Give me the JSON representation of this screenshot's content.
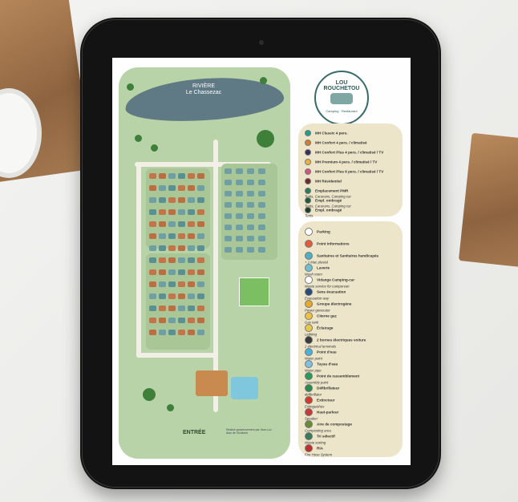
{
  "map": {
    "river_line1": "RIVIÈRE",
    "river_line2": "Le Chassezac",
    "entrance": "ENTRÉE",
    "footer_credit": "Réalisé gracieusement par Jean-Luc Alan de l'Ardèche"
  },
  "brand": {
    "name": "LOU ROUCHETOU",
    "tagline": "Camping · Restaurant"
  },
  "legend_accommodation": [
    {
      "label": "MH Classic 4 pers.",
      "color": "#1aa08f"
    },
    {
      "label": "MH Confort 4 pers. / climatisé",
      "color": "#d97b2f"
    },
    {
      "label": "MH Confort Plus 4 pers. / climatisé / TV",
      "color": "#3a2d5c"
    },
    {
      "label": "MH Premium 4 pers. / climatisé / TV",
      "color": "#f0b33a"
    },
    {
      "label": "MH Confort Plus 6 pers. / climatisé / TV",
      "color": "#d9527f"
    },
    {
      "label": "MH Résidentiel",
      "color": "#6e2a2a"
    },
    {
      "label": "Emplacement PMR",
      "sub": "Tents, Caravans, Camping car",
      "color": "#2b7a5a"
    },
    {
      "label": "Empl. ombragé",
      "sub": "Tents, Caravans, Camping car",
      "color": "#1d5a3a"
    },
    {
      "label": "Empl. ombragé",
      "sub": "Tents",
      "color": "#1a3f2a"
    }
  ],
  "legend_services": [
    {
      "label": "Parking",
      "color": "#ffffff"
    },
    {
      "label": "Point informations",
      "color": "#e45a3a"
    },
    {
      "label": "Sanitaires et Sanitaires handicapés",
      "sub": "+ 1 Mac pluvial",
      "color": "#4db0c4"
    },
    {
      "label": "Laverie",
      "sub": "Wash room",
      "color": "#6fbfcf"
    },
    {
      "label": "Vidange Camping-car",
      "sub": "Waste service for campervan",
      "color": "#ffffff"
    },
    {
      "label": "Sens évacuation",
      "sub": "Evacuation way",
      "color": "#2b4a7a"
    },
    {
      "label": "Groupe électrogène",
      "sub": "Power generator",
      "color": "#e8a82a"
    },
    {
      "label": "Citerne gaz",
      "sub": "Gas tank",
      "color": "#f0c040"
    },
    {
      "label": "Éclairage",
      "sub": "Lighting",
      "color": "#e6c84a"
    },
    {
      "label": "2 bornes électriques voiture",
      "sub": "2 electrical terminals",
      "color": "#3a3a3a"
    },
    {
      "label": "Point d'eau",
      "sub": "Water point",
      "color": "#4ab0d8"
    },
    {
      "label": "Tuyau d'eau",
      "sub": "Water pipe",
      "color": "#7fc0e0"
    },
    {
      "label": "Point de rassemblement",
      "sub": "Assembly point",
      "color": "#2a9a5a"
    },
    {
      "label": "Défibrillateur",
      "sub": "defibrillator",
      "color": "#2a8a4a"
    },
    {
      "label": "Extincteur",
      "sub": "Extinguishes",
      "color": "#d23a2a"
    },
    {
      "label": "Haut-parleur",
      "sub": "Speaker",
      "color": "#c83a3a"
    },
    {
      "label": "Aire de compostage",
      "sub": "Composting area",
      "color": "#6a8a3a"
    },
    {
      "label": "Tri sélectif",
      "sub": "Waste sorting",
      "color": "#3a7a5a"
    },
    {
      "label": "RIA",
      "sub": "Fire Hose System",
      "color": "#c0302a"
    }
  ]
}
